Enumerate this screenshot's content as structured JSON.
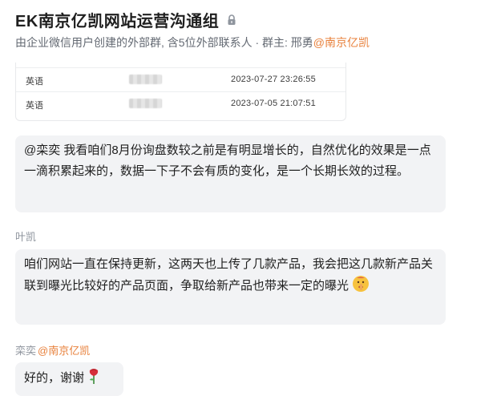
{
  "header": {
    "title": "EK南京亿凯网站运营沟通组",
    "subtitle_prefix": "由企业微信用户创建的外部群, 含5位外部联系人 · 群主: 邢勇",
    "owner_org": "@南京亿凯",
    "lock_icon": "lock-icon"
  },
  "table": {
    "rows": [
      {
        "lang": "英语",
        "value_blurred": true,
        "time": "2023-07-27 23:26:55"
      },
      {
        "lang": "英语",
        "value_blurred": true,
        "time": "2023-07-05 21:07:51"
      }
    ]
  },
  "messages": [
    {
      "sender": "",
      "text": "@栾奕  我看咱们8月份询盘数较之前是有明显增长的，自然优化的效果是一点一滴积累起来的，数据一下子不会有质的变化，是一个长期长效的过程。"
    },
    {
      "sender": "叶凯",
      "text": "咱们网站一直在保持更新，这两天也上传了几款产品，我会把这几款新产品关联到曝光比较好的产品页面，争取给新产品也带来一定的曝光",
      "emoji": "shushing-face-emoji"
    },
    {
      "sender": "栾奕",
      "sender_org": "@南京亿凯",
      "text": "好的，谢谢",
      "emoji": "rose-emoji"
    }
  ],
  "colors": {
    "accent_org": "#e8803b",
    "bubble_bg": "#f2f3f5",
    "muted_text": "#646a73"
  }
}
